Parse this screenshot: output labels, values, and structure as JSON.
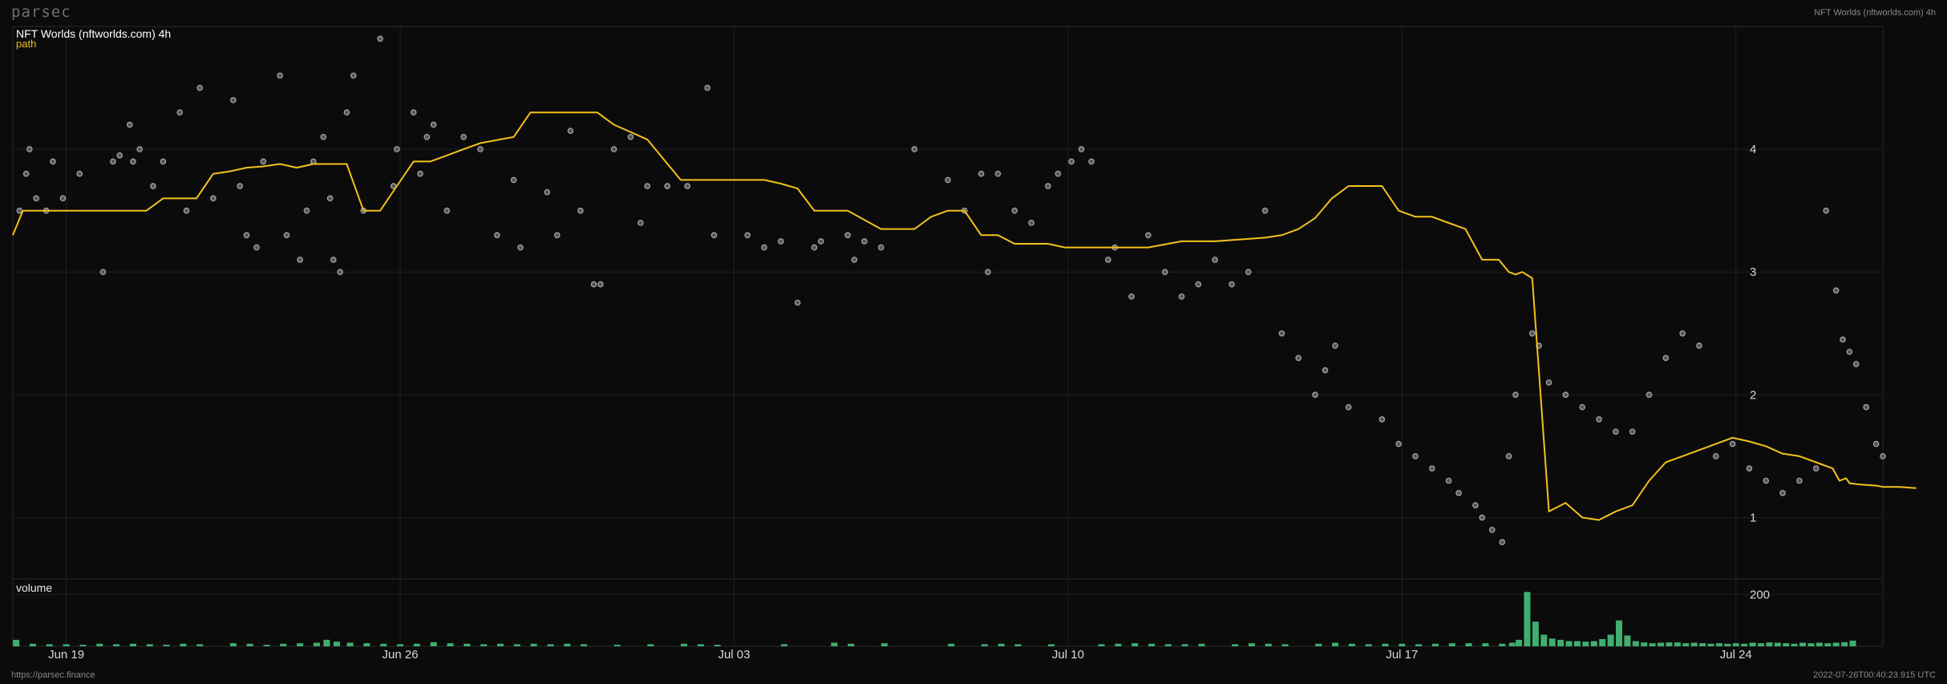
{
  "brand": "parsec",
  "header_right": "NFT Worlds (nftworlds.com) 4h",
  "footer_left": "https://parsec.finance",
  "footer_right": "2022-07-26T00:40:23.915 UTC",
  "chart_data": {
    "type": "line",
    "title": "NFT Worlds (nftworlds.com) 4h",
    "grid": true,
    "price_panel": {
      "series": [
        {
          "name": "path",
          "color": "#f2c21b",
          "x": [
            0,
            0.3,
            1,
            2,
            3,
            3.5,
            4,
            4.5,
            5,
            5.5,
            6,
            6.5,
            7,
            7.5,
            8,
            8.5,
            9,
            9.5,
            10,
            10.5,
            11,
            11.5,
            12,
            12.5,
            13,
            13.5,
            14,
            15,
            15.5,
            16,
            17,
            17.5,
            18,
            19,
            20,
            20.5,
            21,
            21.5,
            22,
            22.5,
            23,
            23.5,
            24,
            24.5,
            25,
            26,
            27,
            27.5,
            28,
            28.5,
            29,
            29.5,
            30,
            31,
            31.5,
            32,
            32.5,
            33,
            34,
            35,
            36,
            36.5,
            37,
            37.5,
            38,
            38.5,
            39,
            39.5,
            40,
            41,
            41.5,
            42,
            42.5,
            43,
            43.5,
            44,
            44.5,
            44.8,
            45,
            45.2,
            45.5,
            46,
            46.5,
            47,
            47.5,
            48,
            48.5,
            49,
            49.5,
            50,
            51,
            51.5,
            52,
            52.5,
            53,
            53.5,
            54,
            54.5,
            54.7,
            54.9,
            55,
            55.3,
            55.8,
            56,
            56.5,
            57
          ],
          "y": [
            3.3,
            3.5,
            3.5,
            3.5,
            3.5,
            3.5,
            3.5,
            3.6,
            3.6,
            3.6,
            3.8,
            3.82,
            3.85,
            3.86,
            3.88,
            3.85,
            3.88,
            3.88,
            3.88,
            3.5,
            3.5,
            3.7,
            3.9,
            3.9,
            3.95,
            4.0,
            4.05,
            4.1,
            4.3,
            4.3,
            4.3,
            4.3,
            4.2,
            4.08,
            3.75,
            3.75,
            3.75,
            3.75,
            3.75,
            3.75,
            3.72,
            3.68,
            3.5,
            3.5,
            3.5,
            3.35,
            3.35,
            3.45,
            3.5,
            3.5,
            3.3,
            3.3,
            3.23,
            3.23,
            3.2,
            3.2,
            3.2,
            3.2,
            3.2,
            3.25,
            3.25,
            3.26,
            3.27,
            3.28,
            3.3,
            3.35,
            3.44,
            3.6,
            3.7,
            3.7,
            3.5,
            3.45,
            3.45,
            3.4,
            3.35,
            3.1,
            3.1,
            3.0,
            2.98,
            3.0,
            2.95,
            1.05,
            1.12,
            1.0,
            0.98,
            1.05,
            1.1,
            1.3,
            1.45,
            1.5,
            1.6,
            1.65,
            1.62,
            1.58,
            1.52,
            1.5,
            1.45,
            1.4,
            1.3,
            1.32,
            1.28,
            1.27,
            1.26,
            1.25,
            1.25,
            1.24
          ]
        },
        {
          "name": "",
          "color": "#a8a8a8",
          "kind": "scatter",
          "x": [
            0.2,
            0.4,
            0.5,
            0.7,
            1,
            1.2,
            1.5,
            2,
            2.7,
            3,
            3.2,
            3.5,
            3.6,
            3.8,
            4.2,
            4.5,
            5,
            5.2,
            5.6,
            6,
            6.6,
            6.8,
            7,
            7.3,
            7.5,
            8,
            8.2,
            8.6,
            8.8,
            9,
            9.3,
            9.5,
            9.6,
            9.8,
            10,
            10.2,
            10.5,
            11,
            11.4,
            11.5,
            12,
            12.2,
            12.4,
            12.6,
            13,
            13.5,
            14,
            14.5,
            15,
            15.2,
            16,
            16.3,
            16.7,
            17,
            17.4,
            17.6,
            18,
            18.5,
            18.8,
            19,
            19.6,
            20.2,
            20.8,
            21,
            22,
            22.5,
            23,
            23.5,
            24,
            24.2,
            25,
            25.2,
            25.5,
            26,
            27,
            28,
            28.5,
            29,
            29.2,
            29.5,
            30,
            30.5,
            31,
            31.3,
            31.7,
            32,
            32.3,
            32.8,
            33,
            33.5,
            34,
            34.5,
            35,
            35.5,
            36,
            36.5,
            37,
            37.5,
            38,
            38.5,
            39,
            39.3,
            39.6,
            40,
            41,
            41.5,
            42,
            42.5,
            43,
            43.3,
            43.8,
            44,
            44.3,
            44.6,
            44.8,
            45,
            45.5,
            45.7,
            46,
            46.5,
            47,
            47.5,
            48,
            48.5,
            49,
            49.5,
            50,
            50.5,
            51,
            51.5,
            52,
            52.5,
            53,
            53.5,
            54,
            54.3,
            54.6,
            54.8,
            55,
            55.2,
            55.5,
            55.8,
            56
          ],
          "y": [
            3.5,
            3.8,
            4.0,
            3.6,
            3.5,
            3.9,
            3.6,
            3.8,
            3.0,
            3.9,
            3.95,
            4.2,
            3.9,
            4.0,
            3.7,
            3.9,
            4.3,
            3.5,
            4.5,
            3.6,
            4.4,
            3.7,
            3.3,
            3.2,
            3.9,
            4.6,
            3.3,
            3.1,
            3.5,
            3.9,
            4.1,
            3.6,
            3.1,
            3.0,
            4.3,
            4.6,
            3.5,
            4.9,
            3.7,
            4.0,
            4.3,
            3.8,
            4.1,
            4.2,
            3.5,
            4.1,
            4.0,
            3.3,
            3.75,
            3.2,
            3.65,
            3.3,
            4.15,
            3.5,
            2.9,
            2.9,
            4.0,
            4.1,
            3.4,
            3.7,
            3.7,
            3.7,
            4.5,
            3.3,
            3.3,
            3.2,
            3.25,
            2.75,
            3.2,
            3.25,
            3.3,
            3.1,
            3.25,
            3.2,
            4.0,
            3.75,
            3.5,
            3.8,
            3.0,
            3.8,
            3.5,
            3.4,
            3.7,
            3.8,
            3.9,
            4.0,
            3.9,
            3.1,
            3.2,
            2.8,
            3.3,
            3.0,
            2.8,
            2.9,
            3.1,
            2.9,
            3.0,
            3.5,
            2.5,
            2.3,
            2.0,
            2.2,
            2.4,
            1.9,
            1.8,
            1.6,
            1.5,
            1.4,
            1.3,
            1.2,
            1.1,
            1.0,
            0.9,
            0.8,
            1.5,
            2.0,
            2.5,
            2.4,
            2.1,
            2.0,
            1.9,
            1.8,
            1.7,
            1.7,
            2.0,
            2.3,
            2.5,
            2.4,
            1.5,
            1.6,
            1.4,
            1.3,
            1.2,
            1.3,
            1.4,
            3.5,
            2.85,
            2.45,
            2.35,
            2.25,
            1.9,
            1.6,
            1.5,
            1.4,
            1.2
          ]
        }
      ],
      "ylim": [
        0.5,
        5.0
      ],
      "yticks": [
        1,
        2,
        3,
        4
      ]
    },
    "volume_panel": {
      "title": "volume",
      "color": "#3fae6f",
      "ylim": [
        0,
        260
      ],
      "yticks": [
        200
      ],
      "bars": [
        {
          "x": 0.1,
          "v": 25
        },
        {
          "x": 0.6,
          "v": 10
        },
        {
          "x": 1.1,
          "v": 8
        },
        {
          "x": 1.6,
          "v": 8
        },
        {
          "x": 2.1,
          "v": 6
        },
        {
          "x": 2.6,
          "v": 10
        },
        {
          "x": 3.1,
          "v": 8
        },
        {
          "x": 3.6,
          "v": 10
        },
        {
          "x": 4.1,
          "v": 8
        },
        {
          "x": 4.6,
          "v": 6
        },
        {
          "x": 5.1,
          "v": 10
        },
        {
          "x": 5.6,
          "v": 8
        },
        {
          "x": 6.6,
          "v": 12
        },
        {
          "x": 7.1,
          "v": 10
        },
        {
          "x": 7.6,
          "v": 6
        },
        {
          "x": 8.1,
          "v": 10
        },
        {
          "x": 8.6,
          "v": 12
        },
        {
          "x": 9.1,
          "v": 14
        },
        {
          "x": 9.4,
          "v": 25
        },
        {
          "x": 9.7,
          "v": 18
        },
        {
          "x": 10.1,
          "v": 14
        },
        {
          "x": 10.6,
          "v": 12
        },
        {
          "x": 11.1,
          "v": 10
        },
        {
          "x": 11.6,
          "v": 8
        },
        {
          "x": 12.1,
          "v": 10
        },
        {
          "x": 12.6,
          "v": 16
        },
        {
          "x": 13.1,
          "v": 12
        },
        {
          "x": 13.6,
          "v": 10
        },
        {
          "x": 14.1,
          "v": 8
        },
        {
          "x": 14.6,
          "v": 10
        },
        {
          "x": 15.1,
          "v": 8
        },
        {
          "x": 15.6,
          "v": 10
        },
        {
          "x": 16.1,
          "v": 8
        },
        {
          "x": 16.6,
          "v": 10
        },
        {
          "x": 17.1,
          "v": 8
        },
        {
          "x": 18.1,
          "v": 6
        },
        {
          "x": 19.1,
          "v": 8
        },
        {
          "x": 20.1,
          "v": 10
        },
        {
          "x": 20.6,
          "v": 8
        },
        {
          "x": 21.1,
          "v": 6
        },
        {
          "x": 23.1,
          "v": 8
        },
        {
          "x": 24.6,
          "v": 14
        },
        {
          "x": 25.1,
          "v": 10
        },
        {
          "x": 26.1,
          "v": 12
        },
        {
          "x": 28.1,
          "v": 10
        },
        {
          "x": 29.1,
          "v": 8
        },
        {
          "x": 29.6,
          "v": 10
        },
        {
          "x": 30.1,
          "v": 8
        },
        {
          "x": 31.1,
          "v": 8
        },
        {
          "x": 32.6,
          "v": 8
        },
        {
          "x": 33.1,
          "v": 10
        },
        {
          "x": 33.6,
          "v": 12
        },
        {
          "x": 34.1,
          "v": 10
        },
        {
          "x": 34.6,
          "v": 8
        },
        {
          "x": 35.1,
          "v": 8
        },
        {
          "x": 35.6,
          "v": 10
        },
        {
          "x": 36.6,
          "v": 8
        },
        {
          "x": 37.1,
          "v": 12
        },
        {
          "x": 37.6,
          "v": 10
        },
        {
          "x": 38.1,
          "v": 8
        },
        {
          "x": 39.1,
          "v": 10
        },
        {
          "x": 39.6,
          "v": 14
        },
        {
          "x": 40.1,
          "v": 10
        },
        {
          "x": 40.6,
          "v": 8
        },
        {
          "x": 41.1,
          "v": 10
        },
        {
          "x": 41.6,
          "v": 10
        },
        {
          "x": 42.1,
          "v": 8
        },
        {
          "x": 42.6,
          "v": 10
        },
        {
          "x": 43.1,
          "v": 12
        },
        {
          "x": 43.6,
          "v": 12
        },
        {
          "x": 44.1,
          "v": 12
        },
        {
          "x": 44.6,
          "v": 10
        },
        {
          "x": 44.9,
          "v": 14
        },
        {
          "x": 45.1,
          "v": 25
        },
        {
          "x": 45.35,
          "v": 210
        },
        {
          "x": 45.6,
          "v": 95
        },
        {
          "x": 45.85,
          "v": 45
        },
        {
          "x": 46.1,
          "v": 30
        },
        {
          "x": 46.35,
          "v": 25
        },
        {
          "x": 46.6,
          "v": 20
        },
        {
          "x": 46.85,
          "v": 20
        },
        {
          "x": 47.1,
          "v": 18
        },
        {
          "x": 47.35,
          "v": 20
        },
        {
          "x": 47.6,
          "v": 28
        },
        {
          "x": 47.85,
          "v": 45
        },
        {
          "x": 48.1,
          "v": 100
        },
        {
          "x": 48.35,
          "v": 42
        },
        {
          "x": 48.6,
          "v": 20
        },
        {
          "x": 48.85,
          "v": 15
        },
        {
          "x": 49.1,
          "v": 12
        },
        {
          "x": 49.35,
          "v": 14
        },
        {
          "x": 49.6,
          "v": 15
        },
        {
          "x": 49.85,
          "v": 15
        },
        {
          "x": 50.1,
          "v": 12
        },
        {
          "x": 50.35,
          "v": 14
        },
        {
          "x": 50.6,
          "v": 12
        },
        {
          "x": 50.85,
          "v": 10
        },
        {
          "x": 51.1,
          "v": 12
        },
        {
          "x": 51.35,
          "v": 10
        },
        {
          "x": 51.6,
          "v": 12
        },
        {
          "x": 51.85,
          "v": 10
        },
        {
          "x": 52.1,
          "v": 14
        },
        {
          "x": 52.35,
          "v": 12
        },
        {
          "x": 52.6,
          "v": 15
        },
        {
          "x": 52.85,
          "v": 14
        },
        {
          "x": 53.1,
          "v": 12
        },
        {
          "x": 53.35,
          "v": 10
        },
        {
          "x": 53.6,
          "v": 14
        },
        {
          "x": 53.85,
          "v": 12
        },
        {
          "x": 54.1,
          "v": 14
        },
        {
          "x": 54.35,
          "v": 12
        },
        {
          "x": 54.6,
          "v": 14
        },
        {
          "x": 54.85,
          "v": 16
        },
        {
          "x": 55.1,
          "v": 22
        }
      ]
    },
    "x_axis": {
      "xlim": [
        0,
        56
      ],
      "ticks": [
        {
          "x": 1.6,
          "label": "Jun 19"
        },
        {
          "x": 11.6,
          "label": "Jun 26"
        },
        {
          "x": 21.6,
          "label": "Jul 03"
        },
        {
          "x": 31.6,
          "label": "Jul 10"
        },
        {
          "x": 41.6,
          "label": "Jul 17"
        },
        {
          "x": 51.6,
          "label": "Jul 24"
        }
      ]
    }
  }
}
